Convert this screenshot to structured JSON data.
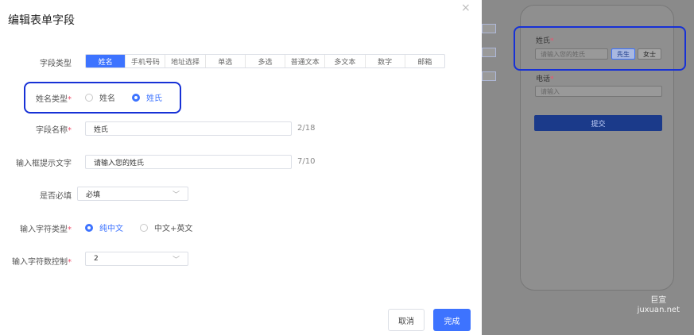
{
  "dialog": {
    "title": "编辑表单字段",
    "close": "×",
    "field_type": {
      "label": "字段类型",
      "options": [
        "姓名",
        "手机号码",
        "地址选择",
        "单选",
        "多选",
        "普通文本",
        "多文本",
        "数字",
        "邮箱"
      ],
      "selected": "姓名"
    },
    "name_type": {
      "label": "姓名类型",
      "required_mark": "*",
      "options": [
        "姓名",
        "姓氏"
      ],
      "selected": "姓氏"
    },
    "field_name": {
      "label": "字段名称",
      "required_mark": "*",
      "value": "姓氏",
      "counter": "2/18"
    },
    "placeholder_text": {
      "label": "输入框提示文字",
      "value": "请输入您的姓氏",
      "counter": "7/10"
    },
    "required": {
      "label": "是否必填",
      "value": "必填"
    },
    "char_type": {
      "label": "输入字符类型",
      "required_mark": "*",
      "options": [
        "纯中文",
        "中文+英文"
      ],
      "selected": "纯中文"
    },
    "char_count": {
      "label": "输入字符数控制",
      "required_mark": "*",
      "value": "2"
    },
    "buttons": {
      "cancel": "取消",
      "done": "完成"
    }
  },
  "preview": {
    "surname": {
      "label": "姓氏",
      "required_mark": "*",
      "placeholder": "请输入您的姓氏",
      "tags": [
        "先生",
        "女士"
      ]
    },
    "phone": {
      "label": "电话",
      "required_mark": "*",
      "placeholder": "请输入"
    },
    "submit": "提交"
  },
  "watermark": {
    "line1": "巨宣",
    "line2": "juxuan.net"
  },
  "colors": {
    "accent": "#3d73ff",
    "highlight": "#1731d6",
    "required": "#f0506e"
  }
}
